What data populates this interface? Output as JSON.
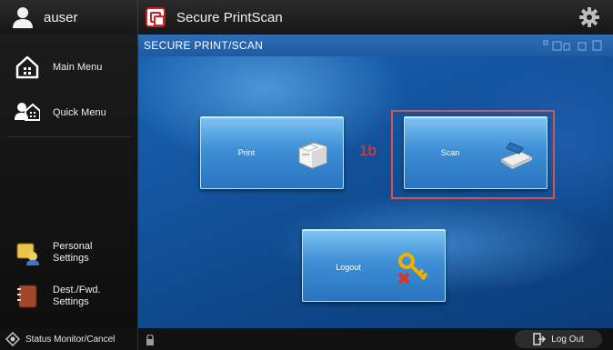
{
  "topbar": {
    "user_name": "auser",
    "app_title": "Secure PrintScan",
    "settings_icon": "gear-icon",
    "app_icon": "secure-printscan-app-icon"
  },
  "sidebar": {
    "items": [
      {
        "label": "Main Menu",
        "icon": "home-icon"
      },
      {
        "label": "Quick Menu",
        "icon": "quick-menu-icon"
      },
      {
        "label": "Personal\nSettings",
        "icon": "personal-settings-icon"
      },
      {
        "label": "Dest./Fwd.\nSettings",
        "icon": "address-book-icon"
      }
    ]
  },
  "main": {
    "header_title": "SECURE PRINT/SCAN",
    "tiles": [
      {
        "label": "Print",
        "icon": "printer-icon"
      },
      {
        "label": "Scan",
        "icon": "scanner-icon"
      },
      {
        "label": "Logout",
        "icon": "keys-icon"
      }
    ],
    "annotation": "1b",
    "colors": {
      "tile_top": "#7fc3f2",
      "tile_bottom": "#2a74bf",
      "highlight": "#d9534f",
      "annotation": "#e04040"
    }
  },
  "statusbar": {
    "status_label": "Status Monitor/Cancel",
    "logout_label": "Log Out"
  }
}
